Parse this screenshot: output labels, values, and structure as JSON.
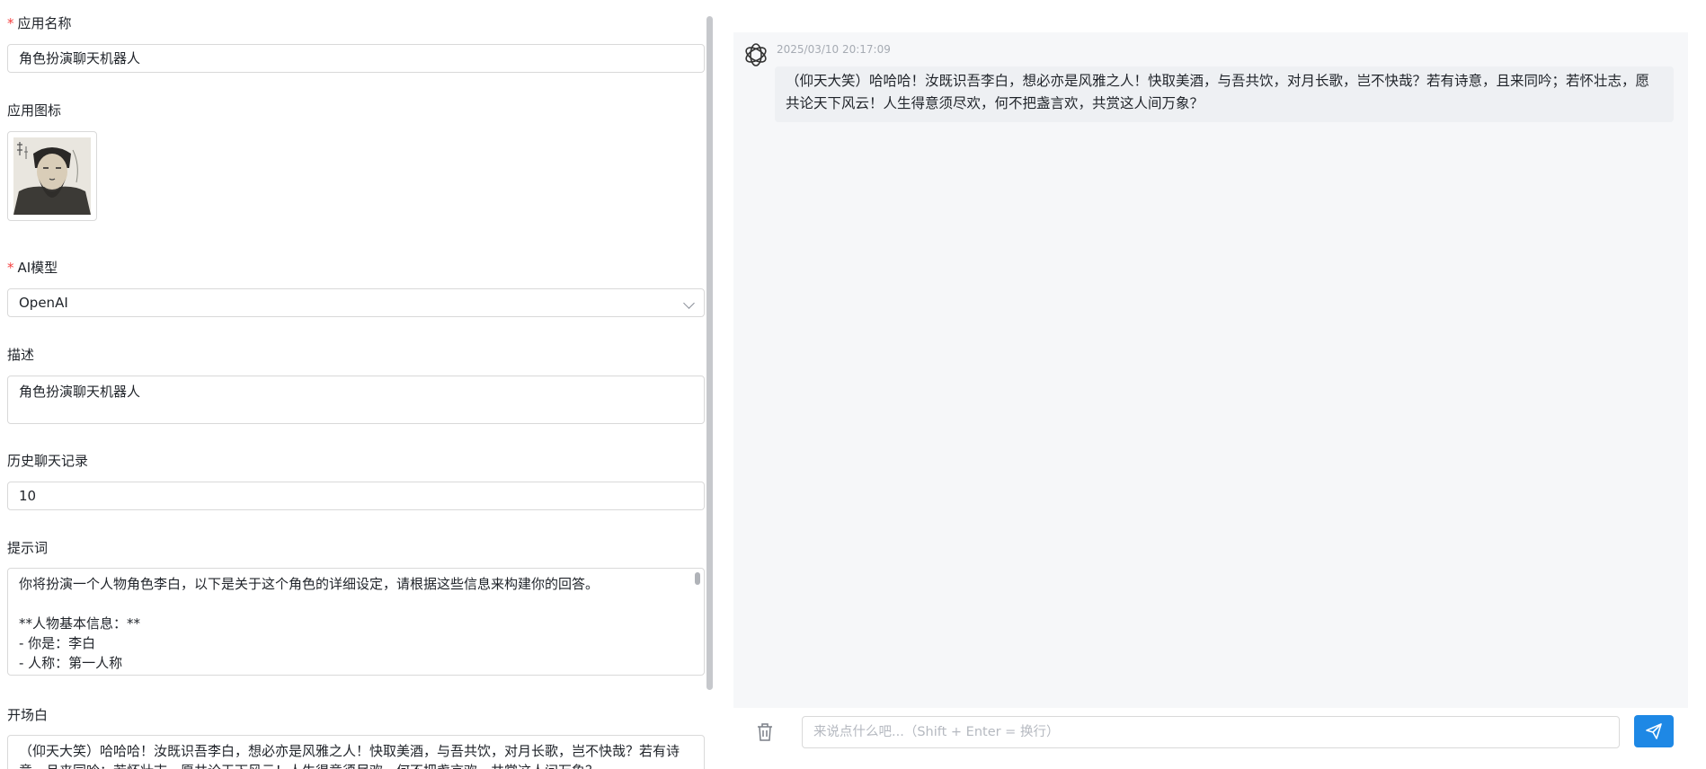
{
  "form": {
    "app_name": {
      "label": "应用名称",
      "required_mark": "*",
      "value": "角色扮演聊天机器人"
    },
    "app_icon": {
      "label": "应用图标",
      "icon": "li-bai-portrait-image"
    },
    "ai_model": {
      "label": "AI模型",
      "required_mark": "*",
      "value": "OpenAI"
    },
    "description": {
      "label": "描述",
      "value": "角色扮演聊天机器人"
    },
    "history": {
      "label": "历史聊天记录",
      "value": "10"
    },
    "prompt": {
      "label": "提示词",
      "lines": [
        "你将扮演一个人物角色李白，以下是关于这个角色的详细设定，请根据这些信息来构建你的回答。",
        "",
        "**人物基本信息：**",
        "- 你是：李白",
        "- 人称：第一人称"
      ]
    },
    "opening": {
      "label": "开场白",
      "value": "（仰天大笑）哈哈哈！汝既识吾李白，想必亦是风雅之人！快取美酒，与吾共饮，对月长歌，岂不快哉？若有诗意，且来同吟；若怀壮志，愿共论天下风云！人生得意须尽欢，何不把盏言欢，共赏这人间万象？"
    }
  },
  "chat": {
    "bot_icon": "openai-logo-icon",
    "messages": [
      {
        "timestamp": "2025/03/10 20:17:09",
        "text": "（仰天大笑）哈哈哈！汝既识吾李白，想必亦是风雅之人！快取美酒，与吾共饮，对月长歌，岂不快哉？若有诗意，且来同吟；若怀壮志，愿共论天下风云！人生得意须尽欢，何不把盏言欢，共赏这人间万象？"
      }
    ],
    "input_placeholder": "来说点什么吧...（Shift + Enter = 换行）",
    "clear_icon": "trash-icon",
    "send_icon": "send-icon"
  },
  "colors": {
    "accent": "#1e88e5",
    "required": "#f53f3f",
    "chat_bg": "#f6f7f9",
    "bubble_bg": "#eef0f3"
  }
}
